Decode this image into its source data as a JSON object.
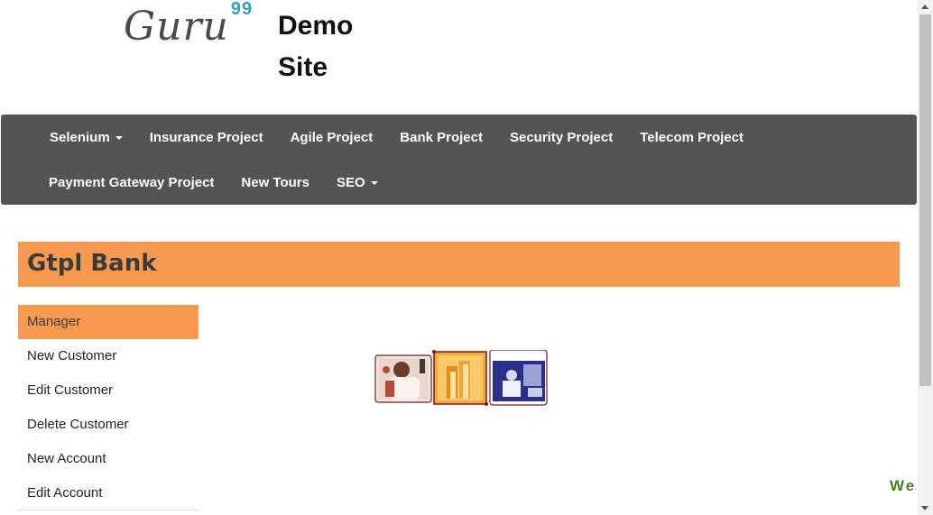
{
  "header": {
    "logo_text": "Guru",
    "logo_sup": "99",
    "demo_line1": "Demo",
    "demo_line2": "Site"
  },
  "nav": {
    "row1": [
      {
        "label": "Selenium",
        "dropdown": true
      },
      {
        "label": "Insurance Project"
      },
      {
        "label": "Agile Project"
      },
      {
        "label": "Bank Project"
      },
      {
        "label": "Security Project"
      },
      {
        "label": "Telecom Project"
      }
    ],
    "row2": [
      {
        "label": "Payment Gateway Project"
      },
      {
        "label": "New Tours"
      },
      {
        "label": "SEO",
        "dropdown": true
      }
    ]
  },
  "bank": {
    "title": "Gtpl Bank"
  },
  "sidebar": {
    "items": [
      {
        "label": "Manager",
        "active": true
      },
      {
        "label": "New Customer"
      },
      {
        "label": "Edit Customer"
      },
      {
        "label": "Delete Customer"
      },
      {
        "label": "New Account"
      },
      {
        "label": "Edit Account"
      }
    ]
  },
  "marquee": {
    "text": "We"
  },
  "colors": {
    "navbar": "#545454",
    "accent": "#f79a50",
    "logo_sup": "#3a9fae",
    "marquee": "#4a7a2a"
  }
}
